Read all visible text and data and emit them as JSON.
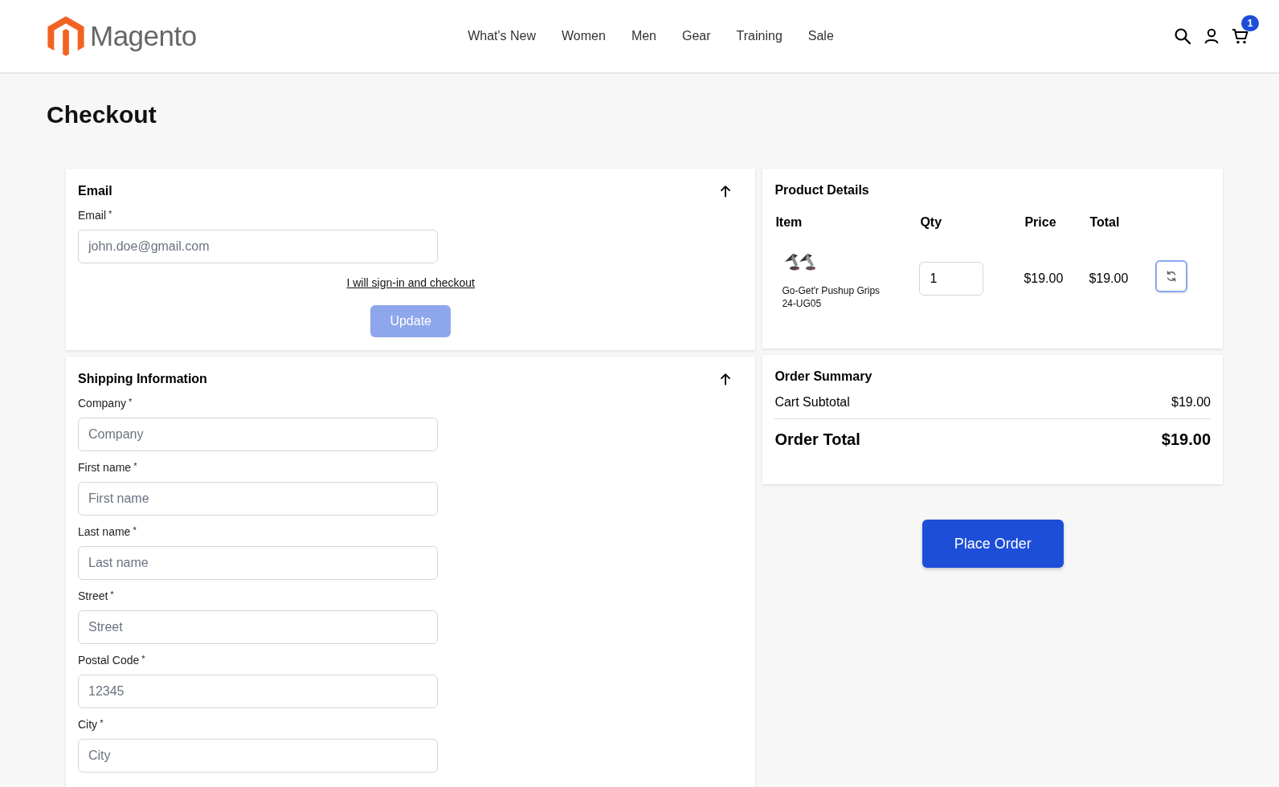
{
  "header": {
    "logo": "Magento",
    "nav": [
      "What's New",
      "Women",
      "Men",
      "Gear",
      "Training",
      "Sale"
    ],
    "cart_count": "1"
  },
  "page_title": "Checkout",
  "email_section": {
    "title": "Email",
    "fields": [
      {
        "label": "Email",
        "mark": "*",
        "placeholder": "john.doe@gmail.com"
      }
    ],
    "link": "I will sign-in and checkout",
    "button": {
      "label": "Update",
      "disabled": true
    }
  },
  "shipping_section": {
    "title": "Shipping Information",
    "fields": [
      {
        "label": "Company",
        "mark": "*",
        "placeholder": "Company"
      },
      {
        "label": "First name",
        "mark": "*",
        "placeholder": "First name"
      },
      {
        "label": "Last name",
        "mark": "*",
        "placeholder": "Last name"
      },
      {
        "label": "Street",
        "mark": "*",
        "placeholder": "Street"
      },
      {
        "label": "Postal Code",
        "mark": "*",
        "placeholder": "12345"
      },
      {
        "label": "City",
        "mark": "*",
        "placeholder": "City"
      }
    ]
  },
  "product_details": {
    "title": "Product Details",
    "columns": [
      "Item",
      "Qty",
      "Price",
      "Total"
    ],
    "rows": [
      {
        "name": "Go-Get'r Pushup Grips",
        "sku": "24-UG05",
        "qty": "1",
        "price": "$19.00",
        "total": "$19.00"
      }
    ]
  },
  "order_summary": {
    "title": "Order Summary",
    "subtotal_label": "Cart Subtotal",
    "subtotal": "$19.00",
    "total_label": "Order Total",
    "total": "$19.00"
  },
  "place_order": "Place Order"
}
